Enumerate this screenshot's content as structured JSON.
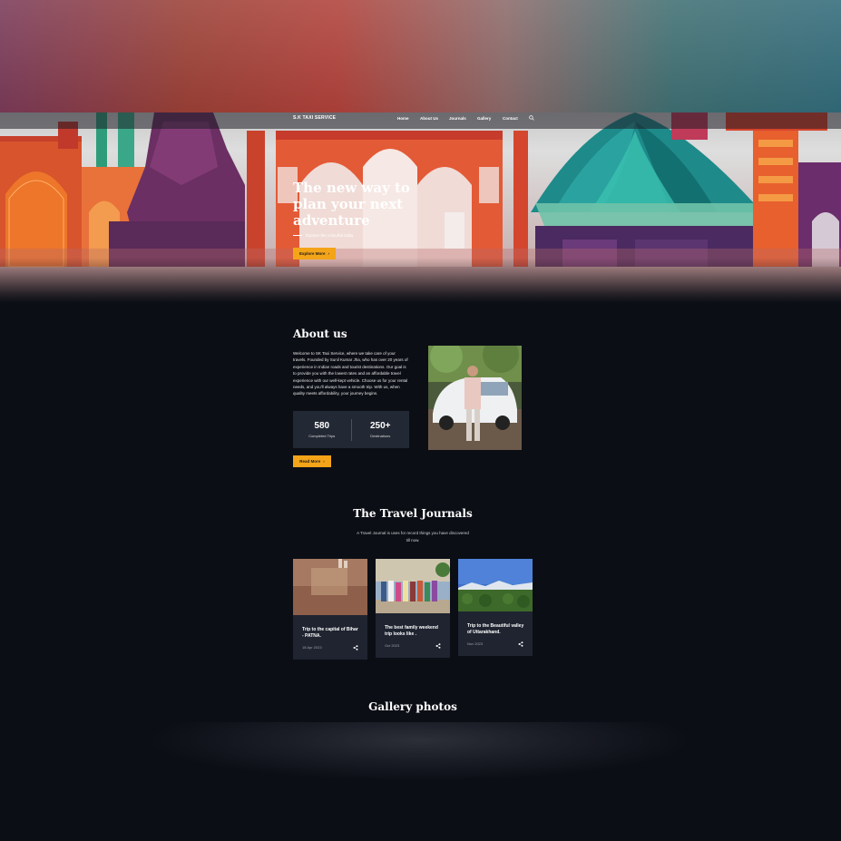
{
  "navbar": {
    "brand": "S.K TAXI SERVICE",
    "items": [
      {
        "label": "Home"
      },
      {
        "label": "About Us"
      },
      {
        "label": "Journals"
      },
      {
        "label": "Gallery"
      },
      {
        "label": "Contact"
      }
    ],
    "search_icon": "search-icon"
  },
  "hero": {
    "title": "The new way to plan your next adventure",
    "subtitle": "Explore the colourful India",
    "button_label": "Explore More",
    "button_icon": "arrow-right-icon",
    "accent_color": "#f3a419"
  },
  "about": {
    "title": "About us",
    "text": "Welcome to SK Taxi Service, where we take care of your travels. Founded by Sunil Kumar Jha, who has over 20 years of experience in Indian roads and tourist destinations. Our goal is to provide you with the lowest rates and an affordable travel experience with our well-kept vehicle. Choose us for your rental needs, and you'll always have a smooth trip. With us, when quality meets affordability, your journey begins.",
    "stats": [
      {
        "value": "580",
        "label": "Completed Trips"
      },
      {
        "value": "250+",
        "label": "Destinations"
      }
    ],
    "button_label": "Read More"
  },
  "journals": {
    "title": "The Travel Journals",
    "description": "A Travel Journal is uses for record things you have discovered till now.",
    "cards": [
      {
        "title": "Trip to the capital of Bihar - PATNA.",
        "date": "18 Apr 2023"
      },
      {
        "title": "The best family weekend trip looks like .",
        "date": "Oct 2023"
      },
      {
        "title": "Trip to the Beautiful valley of Uttarakhand.",
        "date": "Nov 2023"
      }
    ]
  },
  "gallery": {
    "title": "Gallery photos"
  }
}
